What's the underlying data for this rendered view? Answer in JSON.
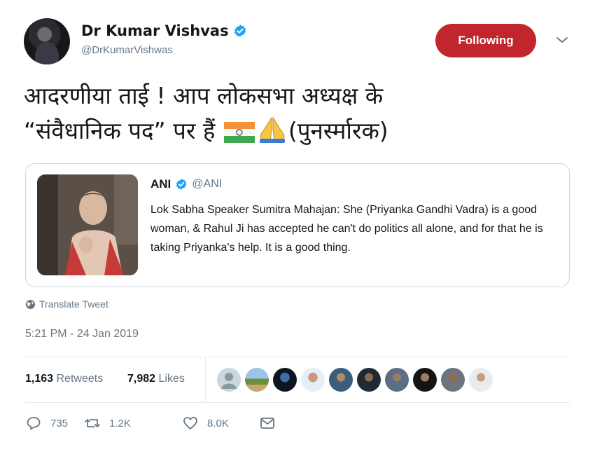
{
  "author": {
    "display_name": "Dr Kumar Vishvas",
    "handle": "@DrKumarVishwas",
    "follow_label": "Following"
  },
  "tweet": {
    "line1": "आदरणीया ताई ! आप लोकसभा अध्यक्ष के",
    "line2_text": "“संवैधानिक पद” पर हैं",
    "line2_suffix": "(पुनर्स्मारक)"
  },
  "quote": {
    "author": "ANI",
    "handle": "@ANI",
    "text": "Lok Sabha Speaker Sumitra Mahajan: She (Priyanka Gandhi Vadra) is a good woman, & Rahul Ji has accepted he can't do politics all alone, and for that he is taking Priyanka's help. It is a good thing."
  },
  "translate_label": "Translate Tweet",
  "timestamp": "5:21 PM - 24 Jan 2019",
  "stats": {
    "retweets_count": "1,163",
    "retweets_label": "Retweets",
    "likes_count": "7,982",
    "likes_label": "Likes"
  },
  "actions": {
    "replies": "735",
    "retweets": "1.2K",
    "likes": "8.0K"
  },
  "colors": {
    "follow_button": "#c0262b",
    "verified": "#1da1f2",
    "muted_text": "#657786"
  },
  "icons": [
    "verified-icon",
    "chevron-down-icon",
    "india-flag-icon",
    "folded-hands-icon",
    "globe-icon",
    "reply-icon",
    "retweet-icon",
    "like-icon",
    "message-icon"
  ]
}
